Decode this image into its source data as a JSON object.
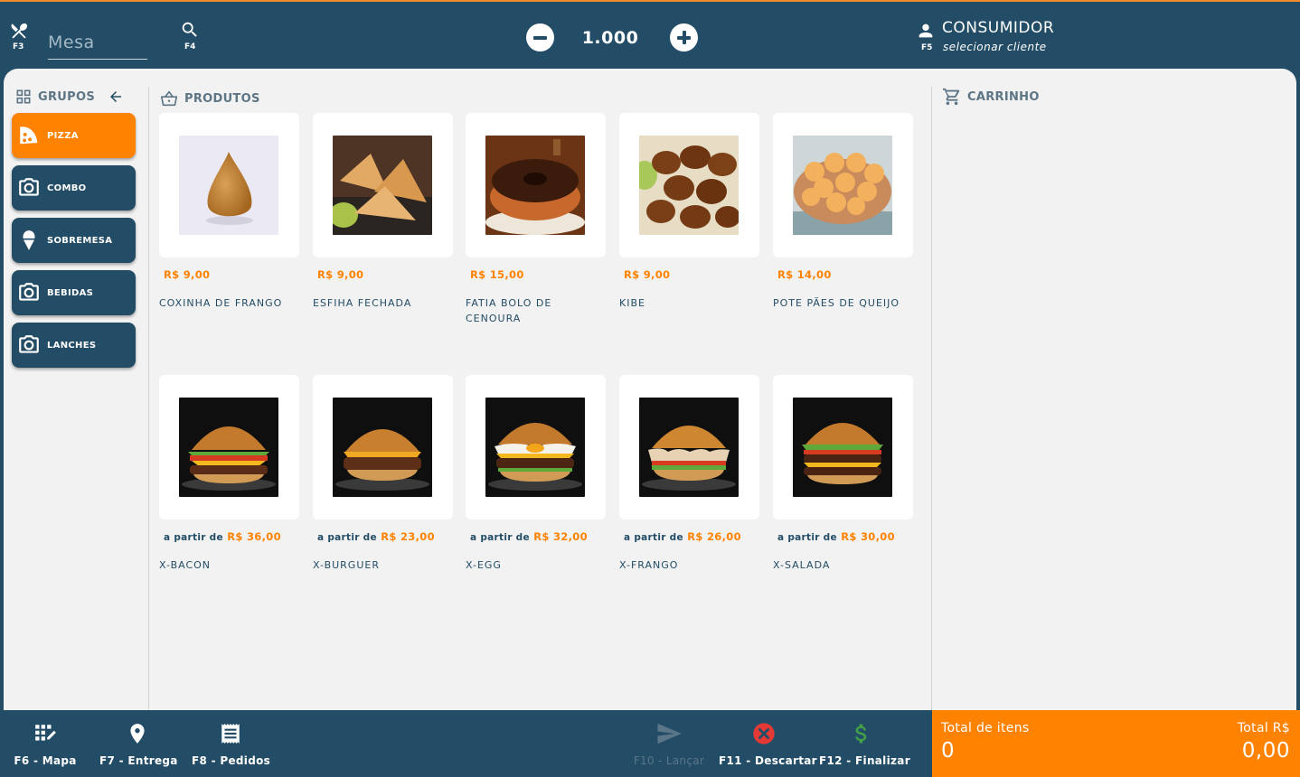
{
  "header": {
    "table_placeholder": "Mesa",
    "table_fkey": "F3",
    "search_fkey": "F4",
    "quantity": "1.000",
    "customer_fkey": "F5",
    "customer_name": "CONSUMIDOR",
    "customer_action": "selecionar cliente"
  },
  "groups": {
    "title": "GRUPOS",
    "items": [
      {
        "label": "PIZZA",
        "icon": "pizza-icon",
        "active": true
      },
      {
        "label": "COMBO",
        "icon": "camera-icon",
        "active": false
      },
      {
        "label": "SOBREMESA",
        "icon": "ice-cream-icon",
        "active": false
      },
      {
        "label": "BEBIDAS",
        "icon": "camera-icon",
        "active": false
      },
      {
        "label": "LANCHES",
        "icon": "camera-icon",
        "active": false
      }
    ]
  },
  "products": {
    "title": "PRODUTOS",
    "price_prefix": "a partir de",
    "items": [
      {
        "name": "COXINHA DE FRANGO",
        "price": "R$ 9,00",
        "from": false,
        "image": "coxinha"
      },
      {
        "name": "ESFIHA FECHADA",
        "price": "R$ 9,00",
        "from": false,
        "image": "esfiha"
      },
      {
        "name": "FATIA BOLO DE CENOURA",
        "price": "R$ 15,00",
        "from": false,
        "image": "bolo"
      },
      {
        "name": "KIBE",
        "price": "R$ 9,00",
        "from": false,
        "image": "kibe"
      },
      {
        "name": "POTE PÃES DE QUEIJO",
        "price": "R$ 14,00",
        "from": false,
        "image": "pao-de-queijo"
      },
      {
        "name": "X-BACON",
        "price": "R$ 36,00",
        "from": true,
        "image": "burger"
      },
      {
        "name": "X-BURGUER",
        "price": "R$ 23,00",
        "from": true,
        "image": "burger"
      },
      {
        "name": "X-EGG",
        "price": "R$ 32,00",
        "from": true,
        "image": "burger"
      },
      {
        "name": "X-FRANGO",
        "price": "R$ 26,00",
        "from": true,
        "image": "burger"
      },
      {
        "name": "X-SALADA",
        "price": "R$ 30,00",
        "from": true,
        "image": "burger"
      }
    ]
  },
  "cart": {
    "title": "CARRINHO",
    "total_items_label": "Total de itens",
    "total_items": "0",
    "total_value_label": "Total R$",
    "total_value": "0,00"
  },
  "footer": {
    "map": "F6 - Mapa",
    "delivery": "F7 - Entrega",
    "orders": "F8 - Pedidos",
    "launch": "F10 - Lançar",
    "discard": "F11 - Descartar",
    "finish": "F12 - Finalizar"
  },
  "colors": {
    "primary": "#234d66",
    "accent": "#ff8200",
    "discard": "#e53935",
    "finish": "#43a047"
  }
}
